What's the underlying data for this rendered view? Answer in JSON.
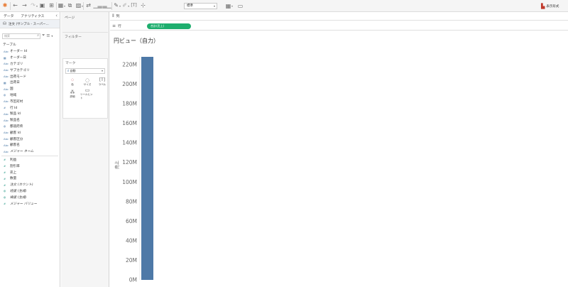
{
  "toolbar": {
    "icons": [
      "tableau-logo-icon",
      "undo-icon",
      "redo-icon",
      "replay-icon",
      "save-icon",
      "add-datasource-icon",
      "new-sheet-icon",
      "duplicate-sheet-icon",
      "clear-sheet-icon",
      "swap-icon",
      "sort-asc-icon",
      "sort-desc-icon",
      "highlight-icon",
      "group-icon",
      "label-icon",
      "pin-axis-icon",
      "fit-icon",
      "presentation-icon"
    ],
    "fit_value": "標準",
    "show_me_label": "表示形式"
  },
  "data_pane": {
    "tabs": [
      "データ",
      "アナリティクス"
    ],
    "datasource": "注文 (サンプル - スーパー...",
    "search_placeholder": "検索",
    "section_title": "テーブル",
    "dimensions": [
      {
        "type": "Abc",
        "label": "オーダー Id"
      },
      {
        "type": "date",
        "label": "オーダー日"
      },
      {
        "type": "Abc",
        "label": "カテゴリ"
      },
      {
        "type": "Abc",
        "label": "サブカテゴリ"
      },
      {
        "type": "Abc",
        "label": "出荷モード"
      },
      {
        "type": "date",
        "label": "出荷日"
      },
      {
        "type": "Abc",
        "label": "国"
      },
      {
        "type": "geo",
        "label": "地域"
      },
      {
        "type": "Abc",
        "label": "市区町村"
      },
      {
        "type": "num",
        "label": "行 Id"
      },
      {
        "type": "Abc",
        "label": "製品 Id"
      },
      {
        "type": "Abc",
        "label": "製品名"
      },
      {
        "type": "geo",
        "label": "都道府県"
      },
      {
        "type": "Abc",
        "label": "顧客 Id"
      },
      {
        "type": "Abc",
        "label": "顧客区分"
      },
      {
        "type": "Abc",
        "label": "顧客名"
      },
      {
        "type": "Abc",
        "label": "メジャー ネーム",
        "italic": true
      }
    ],
    "measures": [
      {
        "type": "num",
        "label": "利益"
      },
      {
        "type": "num",
        "label": "割引率"
      },
      {
        "type": "num",
        "label": "売上"
      },
      {
        "type": "num",
        "label": "数量"
      },
      {
        "type": "num",
        "label": "注文 (カウント)",
        "italic": true
      },
      {
        "type": "geo",
        "label": "経度 (生成)",
        "italic": true
      },
      {
        "type": "geo",
        "label": "緯度 (生成)",
        "italic": true
      },
      {
        "type": "num",
        "label": "メジャー バリュー",
        "italic": true
      }
    ]
  },
  "cards": {
    "pages": "ページ",
    "filters": "フィルター",
    "marks": "マーク",
    "mark_type": "自動",
    "mark_buttons": [
      "色",
      "サイズ",
      "ラベル",
      "詳細",
      "ツールヒント"
    ]
  },
  "shelves": {
    "columns_label": "列",
    "rows_label": "行",
    "rows_pill": "合計(売上)"
  },
  "view": {
    "title": "円ビュー（自力）"
  },
  "chart_data": {
    "type": "bar",
    "categories": [
      ""
    ],
    "series": [
      {
        "values": [
          228000000
        ],
        "color": "#4e79a7"
      }
    ],
    "ylabel": "売上",
    "yticks": [
      "0M",
      "20M",
      "40M",
      "60M",
      "80M",
      "100M",
      "120M",
      "140M",
      "160M",
      "180M",
      "200M",
      "220M"
    ],
    "ylim": [
      0,
      228000000
    ],
    "grid": false
  }
}
